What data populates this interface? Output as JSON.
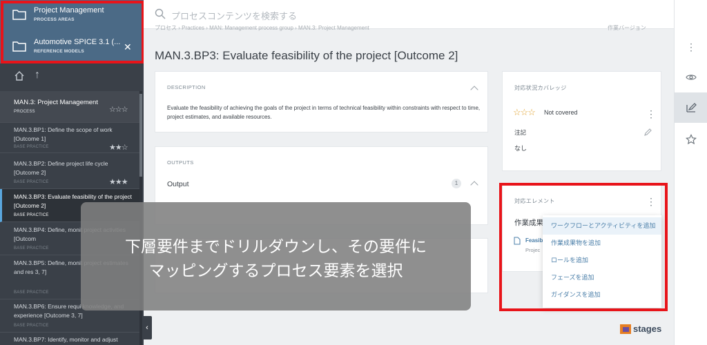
{
  "sidebar": {
    "areas": [
      {
        "title": "Project Management",
        "subtitle": "PROCESS AREAS"
      },
      {
        "title": "Automotive SPICE 3.1 (...",
        "subtitle": "REFERENCE MODELS",
        "close": "✕"
      }
    ],
    "items": [
      {
        "label": "MAN.3: Project Management",
        "type": "PROCESS",
        "stars": "☆☆☆"
      },
      {
        "label": "MAN.3.BP1: Define the scope of work [Outcome 1]",
        "type": "BASE PRACTICE",
        "stars": "★★☆"
      },
      {
        "label": "MAN.3.BP2: Define project life cycle [Outcome 2]",
        "type": "BASE PRACTICE",
        "stars": "★★★"
      },
      {
        "label": "MAN.3.BP3: Evaluate feasibility of the project [Outcome 2]",
        "type": "BASE PRACTICE",
        "stars": ""
      },
      {
        "label": "MAN.3.BP4: Define, monit project activities [Outcom",
        "type": "BASE PRACTICE",
        "stars": ""
      },
      {
        "label": "MAN.3.BP5: Define, monit project estimates and res 3, 7]",
        "type": "BASE PRACTICE",
        "stars": ""
      },
      {
        "label": "MAN.3.BP6: Ensure requi knowledge, and experience [Outcome 3, 7]",
        "type": "BASE PRACTICE",
        "stars": ""
      },
      {
        "label": "MAN.3.BP7: Identify, monitor and adjust",
        "type": "",
        "stars": ""
      }
    ],
    "collapse": "‹"
  },
  "search": {
    "placeholder": "プロセスコンテンツを検索する"
  },
  "breadcrumb": "プロセス › Practices › MAN: Management process group › MAN.3: Project Management",
  "version": "作業バージョン",
  "page_title": "MAN.3.BP3: Evaluate feasibility of the project [Outcome 2]",
  "description": {
    "header": "DESCRIPTION",
    "text": "Evaluate the feasibility of achieving the goals of the project in terms of technical feasibility within constraints with respect to time, project estimates, and available resources."
  },
  "outputs": {
    "header": "OUTPUTS",
    "label": "Output",
    "count": "1"
  },
  "coverage": {
    "header": "対応状況カバレッジ",
    "stars": "☆☆☆",
    "status": "Not covered",
    "note_label": "注記",
    "note_value": "なし"
  },
  "elements": {
    "header": "対応エレメント",
    "subheader": "作業成果",
    "link": "Feasib",
    "link_sub": "Projec"
  },
  "menu": {
    "items": [
      "ワークフローとアクティビティを追加",
      "作業成果物を追加",
      "ロールを追加",
      "フェーズを追加",
      "ガイダンスを追加"
    ]
  },
  "overlay": {
    "line1": "下層要件までドリルダウンし、その要件に",
    "line2": "マッピングするプロセス要素を選択"
  },
  "logo": "stages"
}
